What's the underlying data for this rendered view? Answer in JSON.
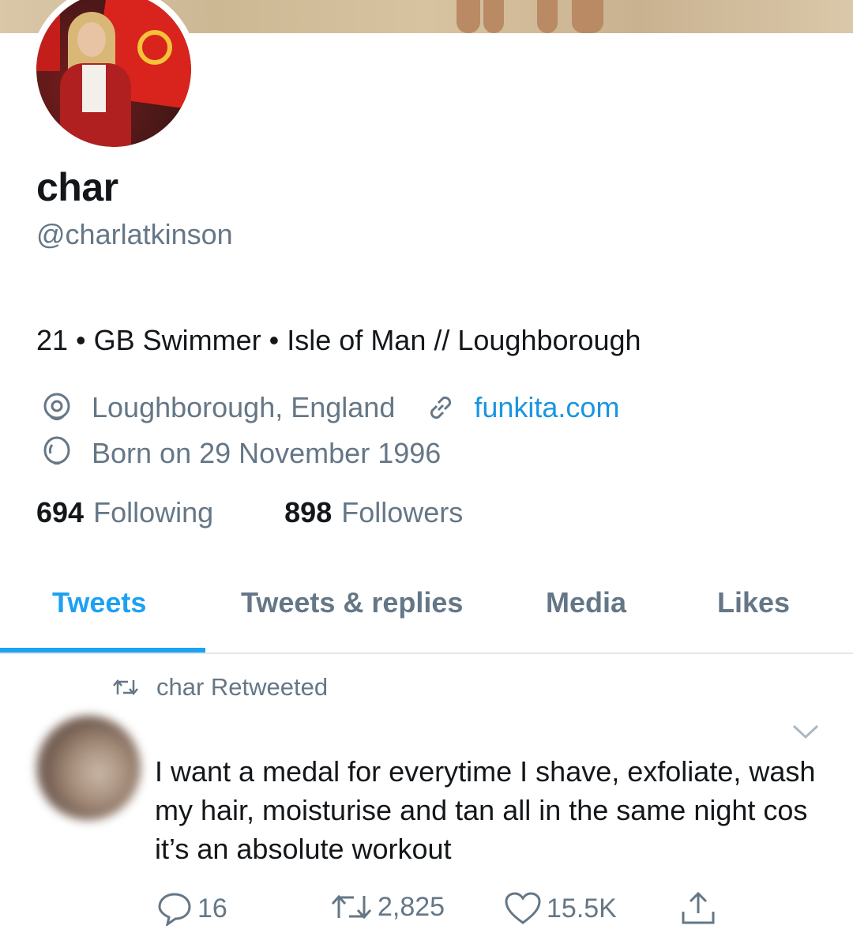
{
  "profile": {
    "name": "char",
    "handle": "@charlatkinson",
    "bio": "21 • GB Swimmer • Isle of Man // Loughborough",
    "location": "Loughborough, England",
    "website": "funkita.com",
    "birthday": "Born on 29 November 1996",
    "following_count": "694",
    "following_label": "Following",
    "followers_count": "898",
    "followers_label": "Followers"
  },
  "tabs": [
    "Tweets",
    "Tweets & replies",
    "Media",
    "Likes"
  ],
  "active_tab": "Tweets",
  "tweet": {
    "retweet_context": "char Retweeted",
    "text": "I want a medal for everytime I shave, exfoliate, wash my hair, moisturise and tan all in the same night cos it’s an absolute workout",
    "replies": "16",
    "retweets": "2,825",
    "likes": "15.5K"
  },
  "colors": {
    "accent": "#1da1f2",
    "link": "#1b95e0",
    "secondary_text": "#657786",
    "primary_text": "#14171a"
  },
  "icons": [
    "location-pin-icon",
    "link-icon",
    "balloon-icon",
    "retweet-icon",
    "chevron-down-icon",
    "reply-icon",
    "like-icon",
    "share-icon"
  ]
}
